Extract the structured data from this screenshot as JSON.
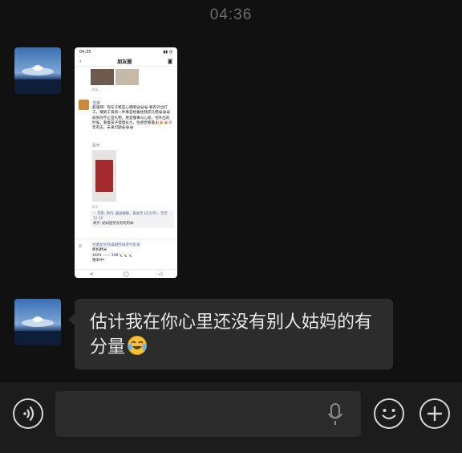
{
  "chat": {
    "timestamp": "04:36",
    "messages": [
      {
        "type": "image",
        "sender": "other",
        "shared_screenshot": {
          "status_time": "04:35",
          "page_title": "朋友圈",
          "time_1": "昨天",
          "author": "范英",
          "post_text": "超强啊！现在子那是心肠啊😀😀😀 要有外出打工，赚到工资第一件事是想着给我买礼物😀😀😀 收到的不止是礼物，更是懂事与心意，他外出的时候，看着孩子慢慢长大，住感觉看着🎉🎉🎉少年有志，未来可期😀😀😀",
          "more_label": "全文",
          "time_2": "昨天",
          "likes_text": "♡ 范英, 周丹, 姜丽敏敏，黄丽华 (向力平)，芳芳12.10",
          "comment_text": "周丹: 姑妈屋然没有的用😂",
          "next_author": "经典星农",
          "next_post_lines": [
            "经典星农我喜期西域游行街道",
            "新妈胖米",
            "1691 —— 199🍾🍾🍾",
            "赠单中!"
          ],
          "bottom_icons": [
            "<",
            "◯",
            "◁"
          ]
        }
      },
      {
        "type": "text",
        "sender": "other",
        "text": "估计我在你心里还没有别人姑妈的有分量",
        "emoji": "laughing-crying-emoji"
      }
    ]
  },
  "input_bar": {
    "placeholder": "",
    "value": "",
    "voice_icon": "voice-wave-icon",
    "mic_icon": "microphone-icon",
    "emoji_icon": "smiley-icon",
    "plus_icon": "plus-icon"
  },
  "colors": {
    "background": "#111111",
    "bubble": "#2c2c2c",
    "input_bar": "#1c1c1c",
    "link_blue": "#576b95"
  }
}
